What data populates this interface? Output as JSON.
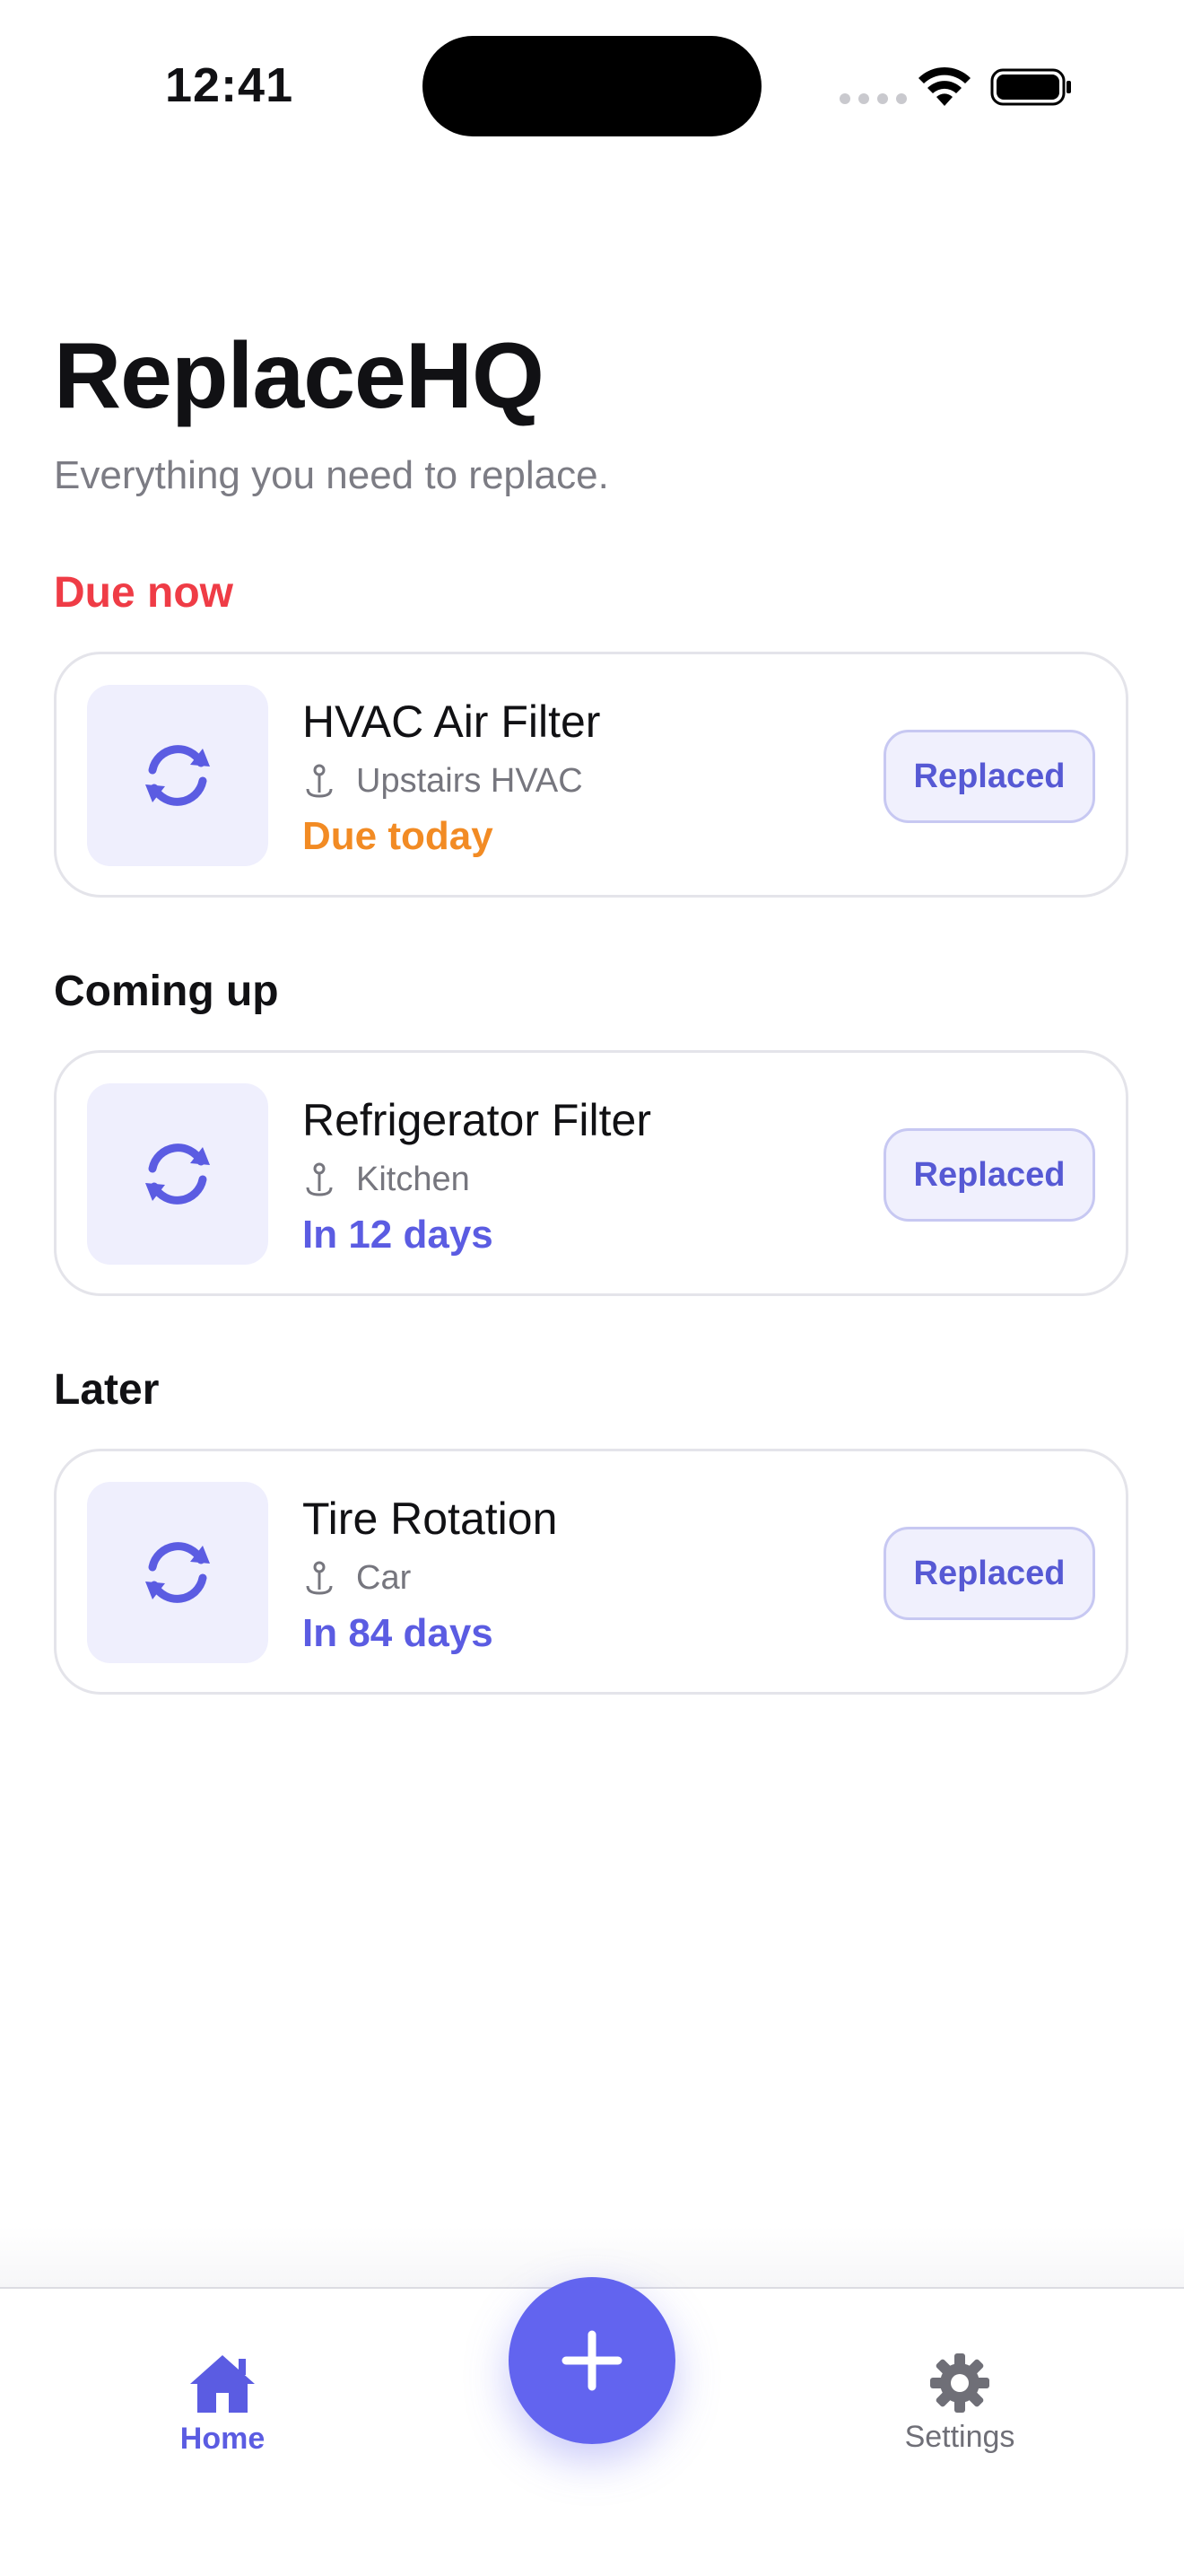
{
  "status_bar": {
    "time": "12:41"
  },
  "header": {
    "title": "ReplaceHQ",
    "subtitle": "Everything you need to replace."
  },
  "sections": [
    {
      "label": "Due now",
      "items": [
        {
          "name": "HVAC Air Filter",
          "location": "Upstairs HVAC",
          "due": "Due today",
          "action": "Replaced"
        }
      ]
    },
    {
      "label": "Coming up",
      "items": [
        {
          "name": "Refrigerator Filter",
          "location": "Kitchen",
          "due": "In 12 days",
          "action": "Replaced"
        }
      ]
    },
    {
      "label": "Later",
      "items": [
        {
          "name": "Tire Rotation",
          "location": "Car",
          "due": "In 84 days",
          "action": "Replaced"
        }
      ]
    }
  ],
  "tabs": {
    "home": "Home",
    "settings": "Settings"
  },
  "icons": {
    "item": "refresh-icon",
    "location": "pin-icon",
    "add": "plus-icon",
    "home": "house-icon",
    "settings": "gear-icon"
  },
  "colors": {
    "accent": "#5b5ce2",
    "due_now": "#ef3c46",
    "due_today": "#f28b24"
  }
}
